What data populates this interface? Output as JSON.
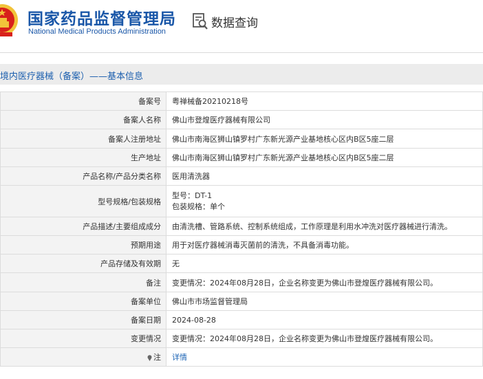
{
  "header": {
    "logo_cn": "国家药品监督管理局",
    "logo_en": "National Medical Products Administration",
    "query_label": "数据查询"
  },
  "section": {
    "title": "境内医疗器械（备案）——基本信息"
  },
  "rows": [
    {
      "label": "备案号",
      "value": "粤禅械备20210218号"
    },
    {
      "label": "备案人名称",
      "value": "佛山市登煌医疗器械有限公司"
    },
    {
      "label": "备案人注册地址",
      "value": "佛山市南海区狮山镇罗村广东新光源产业基地核心区内B区5座二层"
    },
    {
      "label": "生产地址",
      "value": "佛山市南海区狮山镇罗村广东新光源产业基地核心区内B区5座二层"
    },
    {
      "label": "产品名称/产品分类名称",
      "value": "医用清洗器"
    },
    {
      "label": "型号规格/包装规格",
      "value_lines": [
        "型号：DT-1",
        "包装规格：单个"
      ]
    },
    {
      "label": "产品描述/主要组成成分",
      "value": "由清洗槽、管路系统、控制系统组成，工作原理是利用水冲洗对医疗器械进行清洗。"
    },
    {
      "label": "预期用途",
      "value": "用于对医疗器械消毒灭菌前的清洗，不具备消毒功能。"
    },
    {
      "label": "产品存储及有效期",
      "value": "无"
    },
    {
      "label": "备注",
      "value": "变更情况：2024年08月28日，企业名称变更为佛山市登煌医疗器械有限公司。"
    },
    {
      "label": "备案单位",
      "value": "佛山市市场监督管理局"
    },
    {
      "label": "备案日期",
      "value": "2024-08-28"
    },
    {
      "label": "变更情况",
      "value": "变更情况：2024年08月28日，企业名称变更为佛山市登煌医疗器械有限公司。"
    },
    {
      "label": "注",
      "label_icon": "pin-icon",
      "value": "详情",
      "value_is_link": true
    }
  ],
  "colors": {
    "brand_blue": "#1a57a8",
    "link_blue": "#1c64b5",
    "emblem_red": "#d8201b",
    "emblem_gold": "#f2c33a"
  }
}
